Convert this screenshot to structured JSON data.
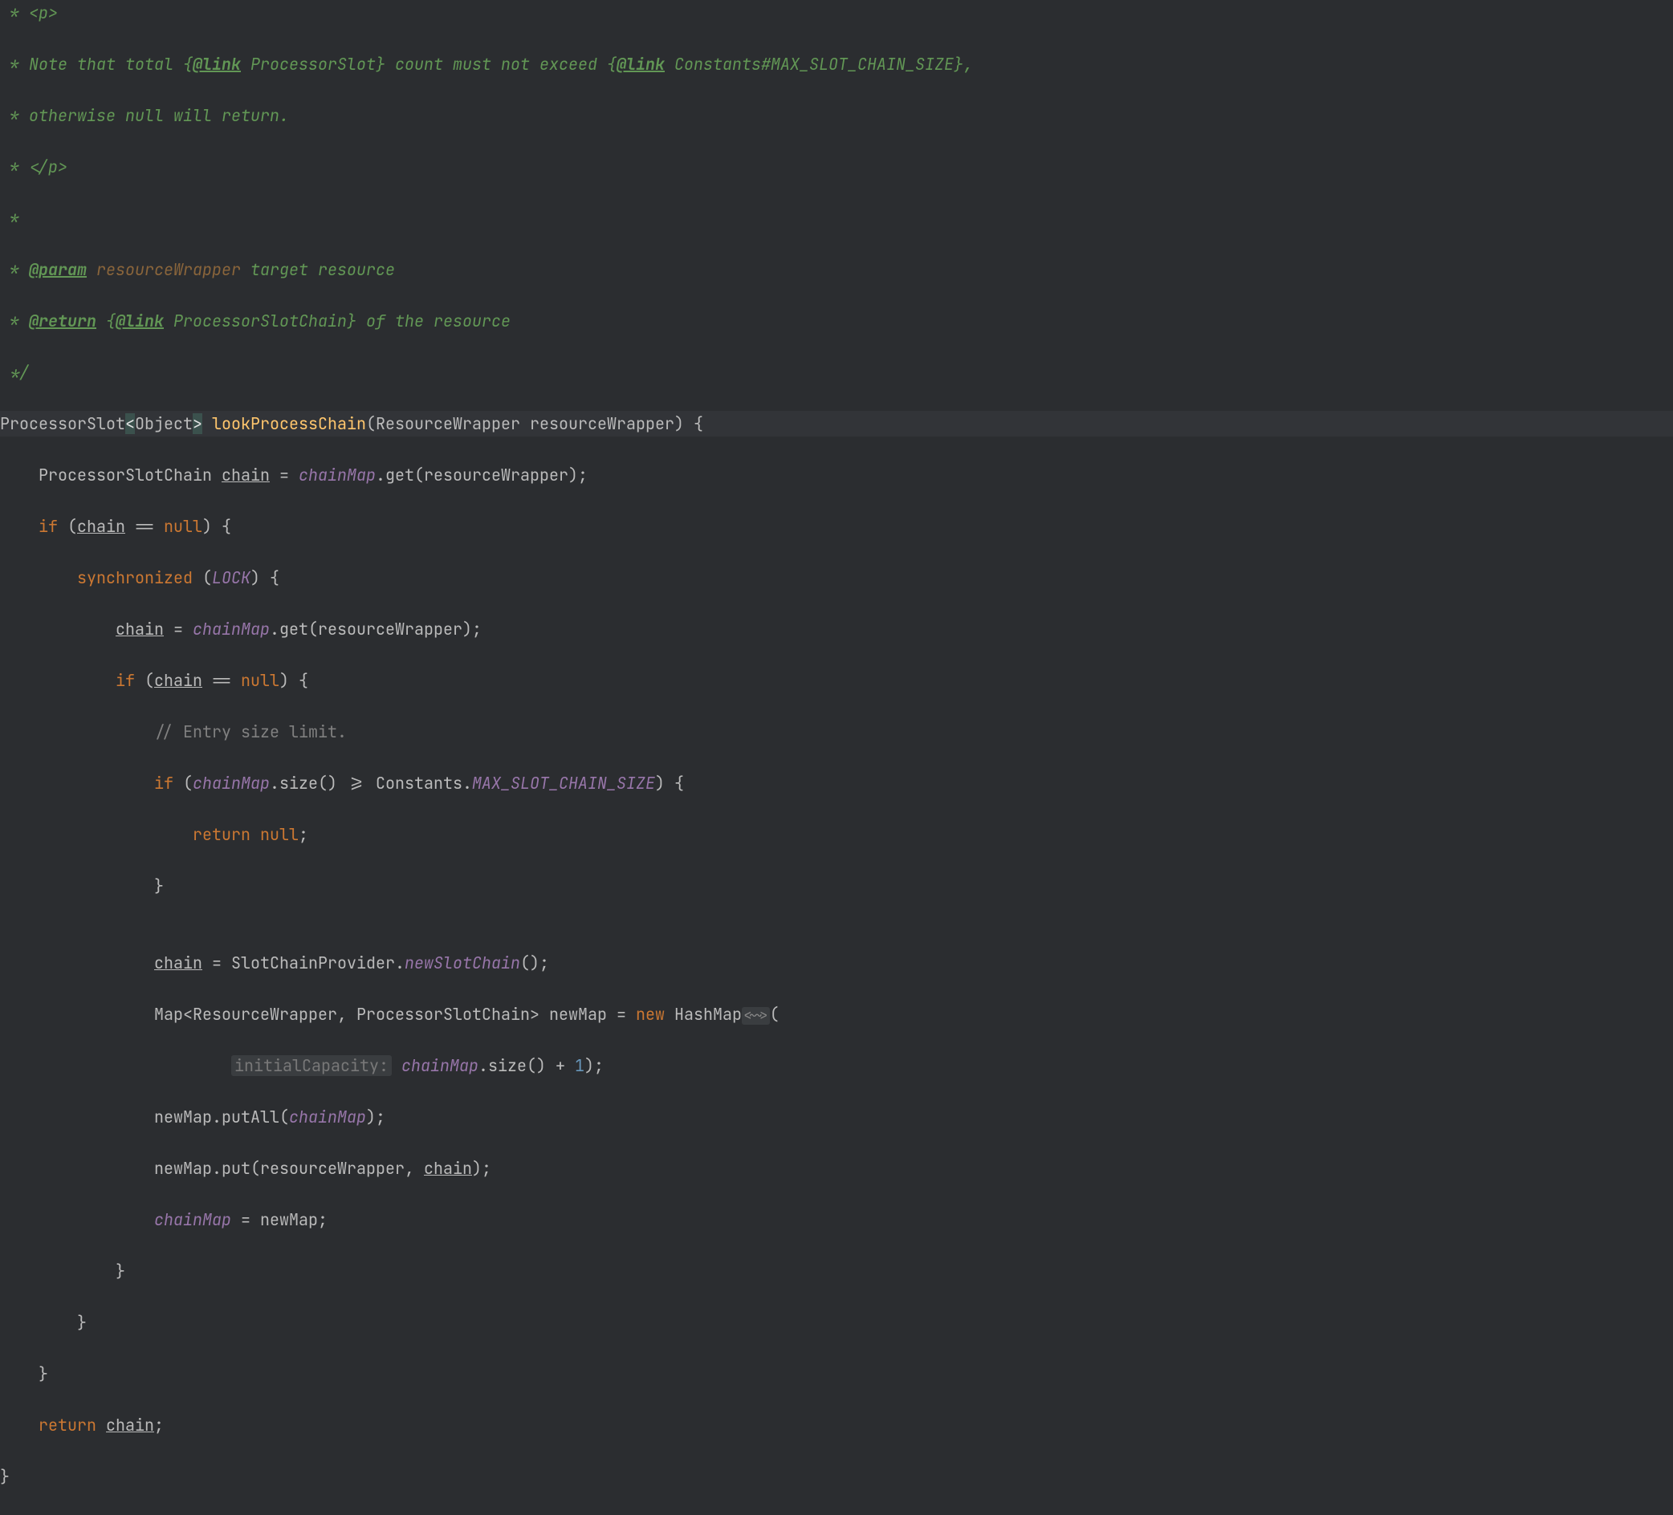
{
  "doc": {
    "l1": " * <p>",
    "l2a": " * Note that total {",
    "l2b": "@link",
    "l2c": " ProcessorSlot} count must not exceed {",
    "l2d": "@link",
    "l2e": " Constants#MAX_SLOT_CHAIN_SIZE},",
    "l3": " * otherwise null will return.",
    "l4": " * </p>",
    "l5": " *",
    "l6a": " * ",
    "l6b": "@param",
    "l6c": " resourceWrapper",
    "l6d": " target resource",
    "l7a": " * ",
    "l7b": "@return",
    "l7c": " {",
    "l7d": "@link",
    "l7e": " ProcessorSlotChain} of the resource",
    "l8": " */"
  },
  "code": {
    "sig": {
      "ret": "ProcessorSlot",
      "lt": "<",
      "obj": "Object",
      "gt": ">",
      "name": " lookProcessChain",
      "params": "(ResourceWrapper resourceWrapper) {"
    },
    "l10a": "    ProcessorSlotChain ",
    "l10b": "chain",
    "l10c": " = ",
    "l10d": "chainMap",
    "l10e": ".get(resourceWrapper);",
    "l11a": "    ",
    "l11if": "if",
    "l11b": " (",
    "l11c": "chain",
    "l11d": " == ",
    "l11e": "null",
    "l11f": ") {",
    "l12a": "        ",
    "l12sync": "synchronized",
    "l12b": " (",
    "l12c": "LOCK",
    "l12d": ") {",
    "l13a": "            ",
    "l13b": "chain",
    "l13c": " = ",
    "l13d": "chainMap",
    "l13e": ".get(resourceWrapper);",
    "l14a": "            ",
    "l14if": "if",
    "l14b": " (",
    "l14c": "chain",
    "l14d": " == ",
    "l14e": "null",
    "l14f": ") {",
    "l15a": "                ",
    "l15b": "// Entry size limit.",
    "l16a": "                ",
    "l16if": "if",
    "l16b": " (",
    "l16c": "chainMap",
    "l16d": ".size() >= Constants.",
    "l16e": "MAX_SLOT_CHAIN_SIZE",
    "l16f": ") {",
    "l17a": "                    ",
    "l17ret": "return ",
    "l17null": "null",
    "l17semi": ";",
    "l18": "                }",
    "l19": "",
    "l20a": "                ",
    "l20b": "chain",
    "l20c": " = SlotChainProvider.",
    "l20d": "newSlotChain",
    "l20e": "();",
    "l21a": "                Map<ResourceWrapper, ProcessorSlotChain> newMap = ",
    "l21new": "new",
    "l21b": " HashMap",
    "l21hint": "<~>",
    "l21c": "(",
    "l22a": "                        ",
    "l22hint": "initialCapacity:",
    "l22b": " ",
    "l22c": "chainMap",
    "l22d": ".size() + ",
    "l22num": "1",
    "l22e": ");",
    "l23a": "                newMap.putAll(",
    "l23b": "chainMap",
    "l23c": ");",
    "l24a": "                newMap.put(resourceWrapper, ",
    "l24b": "chain",
    "l24c": ");",
    "l25a": "                ",
    "l25b": "chainMap",
    "l25c": " = newMap;",
    "l26": "            }",
    "l27": "        }",
    "l28": "    }",
    "l29a": "    ",
    "l29ret": "return",
    "l29b": " ",
    "l29c": "chain",
    "l29d": ";",
    "l30": "}"
  }
}
